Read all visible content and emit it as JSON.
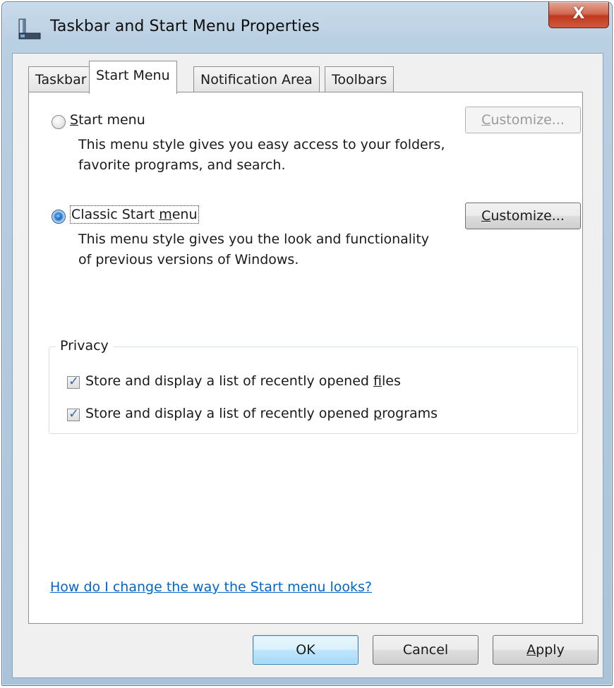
{
  "window": {
    "title": "Taskbar and Start Menu Properties",
    "close_label": "X"
  },
  "tabs": [
    {
      "label": "Taskbar",
      "active": false
    },
    {
      "label": "Start Menu",
      "active": true
    },
    {
      "label": "Notification Area",
      "active": false
    },
    {
      "label": "Toolbars",
      "active": false
    }
  ],
  "start_menu_option": {
    "label_prefix": "",
    "label_hotkey": "S",
    "label_rest": "tart menu",
    "description": "This menu style gives you easy access to your folders, favorite programs, and search.",
    "selected": false,
    "customize_button": {
      "hotkey": "C",
      "rest": "ustomize...",
      "enabled": false
    }
  },
  "classic_option": {
    "label_prefix": "Classic Start ",
    "label_hotkey": "m",
    "label_rest": "enu",
    "description": "This menu style gives you the look and functionality of previous versions of Windows.",
    "selected": true,
    "customize_button": {
      "hotkey": "C",
      "rest": "ustomize...",
      "enabled": true
    }
  },
  "privacy": {
    "group_label": "Privacy",
    "items": [
      {
        "prefix": "Store and display a list of recently opened ",
        "hotkey": "f",
        "rest": "iles",
        "checked": true
      },
      {
        "prefix": "Store and display a list of recently opened ",
        "hotkey": "p",
        "rest": "rograms",
        "checked": true
      }
    ]
  },
  "help_link": "How do I change the way the Start menu looks?",
  "buttons": {
    "ok": "OK",
    "cancel": "Cancel",
    "apply_hotkey": "A",
    "apply_rest": "pply"
  },
  "colors": {
    "link": "#0066cc",
    "check": "#3a6aa8",
    "close_button": "#c0391f"
  }
}
